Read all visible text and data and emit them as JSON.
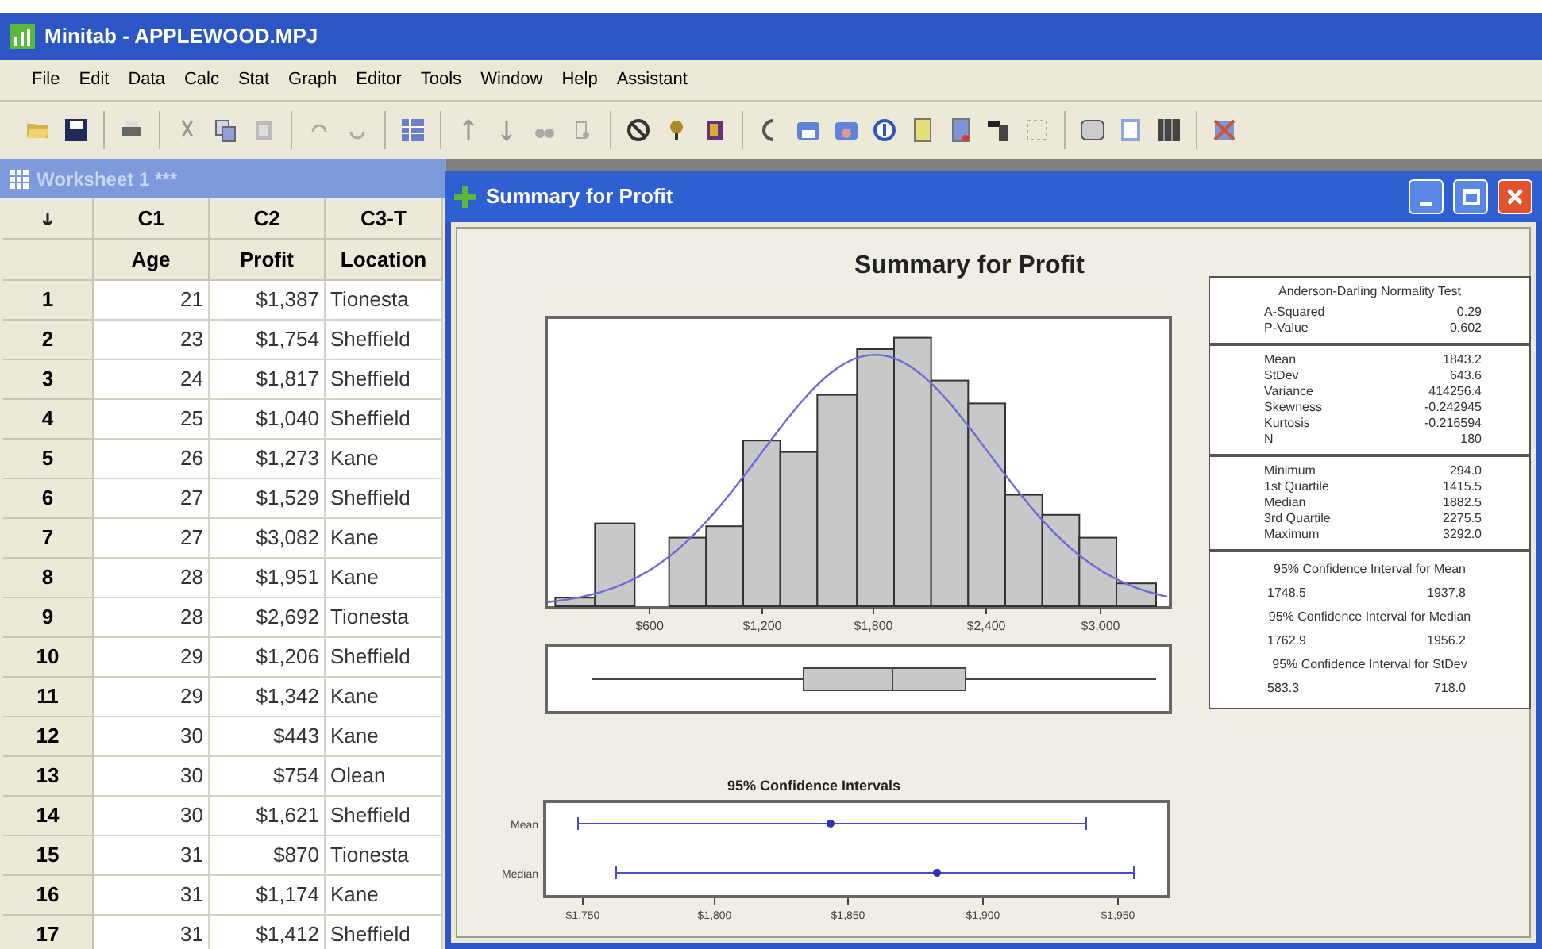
{
  "app_window": {
    "title": "Minitab - APPLEWOOD.MPJ"
  },
  "menu": [
    "File",
    "Edit",
    "Data",
    "Calc",
    "Stat",
    "Graph",
    "Editor",
    "Tools",
    "Window",
    "Help",
    "Assistant"
  ],
  "worksheet": {
    "title": "Worksheet 1 ***",
    "columns": [
      {
        "id": "C1",
        "name": "Age"
      },
      {
        "id": "C2",
        "name": "Profit"
      },
      {
        "id": "C3-T",
        "name": "Location"
      }
    ],
    "rows": [
      {
        "number": "1",
        "cells": [
          "21",
          "$1,387",
          "Tionesta"
        ]
      },
      {
        "number": "2",
        "cells": [
          "23",
          "$1,754",
          "Sheffield"
        ]
      },
      {
        "number": "3",
        "cells": [
          "24",
          "$1,817",
          "Sheffield"
        ]
      },
      {
        "number": "4",
        "cells": [
          "25",
          "$1,040",
          "Sheffield"
        ]
      },
      {
        "number": "5",
        "cells": [
          "26",
          "$1,273",
          "Kane"
        ]
      },
      {
        "number": "6",
        "cells": [
          "27",
          "$1,529",
          "Sheffield"
        ]
      },
      {
        "number": "7",
        "cells": [
          "27",
          "$3,082",
          "Kane"
        ]
      },
      {
        "number": "8",
        "cells": [
          "28",
          "$1,951",
          "Kane"
        ]
      },
      {
        "number": "9",
        "cells": [
          "28",
          "$2,692",
          "Tionesta"
        ]
      },
      {
        "number": "10",
        "cells": [
          "29",
          "$1,206",
          "Sheffield"
        ]
      },
      {
        "number": "11",
        "cells": [
          "29",
          "$1,342",
          "Kane"
        ]
      },
      {
        "number": "12",
        "cells": [
          "30",
          "$443",
          "Kane"
        ]
      },
      {
        "number": "13",
        "cells": [
          "30",
          "$754",
          "Olean"
        ]
      },
      {
        "number": "14",
        "cells": [
          "30",
          "$1,621",
          "Sheffield"
        ]
      },
      {
        "number": "15",
        "cells": [
          "31",
          "$870",
          "Tionesta"
        ]
      },
      {
        "number": "16",
        "cells": [
          "31",
          "$1,174",
          "Kane"
        ]
      },
      {
        "number": "17",
        "cells": [
          "31",
          "$1,412",
          "Sheffield"
        ]
      }
    ]
  },
  "graph_window": {
    "title": "Summary for Profit",
    "graph_title": "Summary for Profit",
    "histogram_ticks": [
      "$600",
      "$1,200",
      "$1,800",
      "$2,400",
      "$3,000"
    ],
    "ci_title": "95% Confidence Intervals",
    "ci_labels": [
      "Mean",
      "Median"
    ],
    "ci_ticks": [
      "$1,750",
      "$1,800",
      "$1,850",
      "$1,900",
      "$1,950"
    ],
    "stats_sections": [
      {
        "kind": "table",
        "heading": "Anderson-Darling Normality Test",
        "rows": [
          {
            "label": "A-Squared",
            "value": "0.29"
          },
          {
            "label": "P-Value",
            "value": "0.602"
          }
        ]
      },
      {
        "kind": "table",
        "rows": [
          {
            "label": "Mean",
            "value": "1843.2"
          },
          {
            "label": "StDev",
            "value": "643.6"
          },
          {
            "label": "Variance",
            "value": "414256.4"
          },
          {
            "label": "Skewness",
            "value": "-0.242945"
          },
          {
            "label": "Kurtosis",
            "value": "-0.216594"
          },
          {
            "label": "N",
            "value": "180"
          }
        ]
      },
      {
        "kind": "table",
        "rows": [
          {
            "label": "Minimum",
            "value": "294.0"
          },
          {
            "label": "1st Quartile",
            "value": "1415.5"
          },
          {
            "label": "Median",
            "value": "1882.5"
          },
          {
            "label": "3rd Quartile",
            "value": "2275.5"
          },
          {
            "label": "Maximum",
            "value": "3292.0"
          }
        ]
      },
      {
        "kind": "intervals",
        "items": [
          {
            "heading": "95% Confidence Interval for Mean",
            "low": "1748.5",
            "high": "1937.8"
          },
          {
            "heading": "95% Confidence Interval for Median",
            "low": "1762.9",
            "high": "1956.2"
          },
          {
            "heading": "95% Confidence Interval for StDev",
            "low": "583.3",
            "high": "718.0"
          }
        ]
      }
    ]
  }
}
